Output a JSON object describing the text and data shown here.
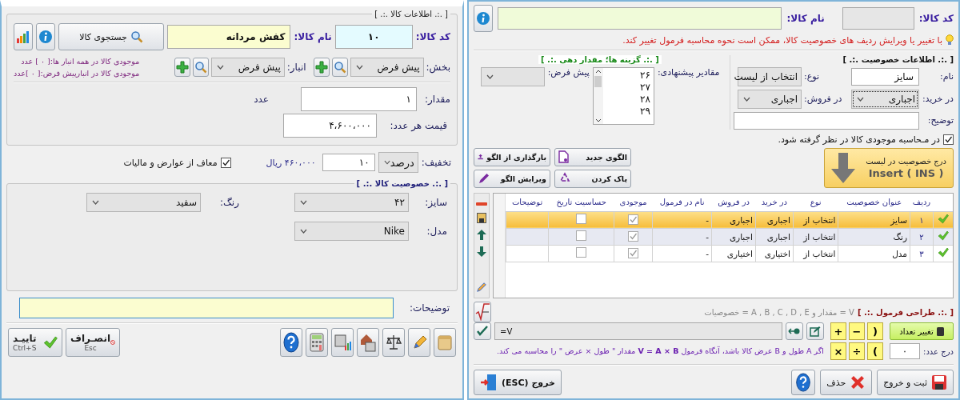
{
  "product_window": {
    "info_legend": "[ .:. اطلاعات کالا .:. ]",
    "code": {
      "label": "کد کالا:",
      "value": "۱۰"
    },
    "name": {
      "label": "نام کالا:",
      "value": "کفش مردانه"
    },
    "search_button": "جستجوی کالا",
    "section": {
      "label": "بخش:",
      "value": "پیش فرض"
    },
    "warehouse": {
      "label": "انبار:",
      "value": "پیش فرض"
    },
    "stock_lines": [
      "موجودی کالا در همه انبار ها:[ ۰ ] عدد",
      "موجودی کالا در انبارپیش فرض:[ ۰ ]عدد"
    ],
    "quantity": {
      "label": "مقدار:",
      "value": "۱",
      "unit": "عدد"
    },
    "unit_price": {
      "label": "قیمت هر عدد:",
      "value": "۴،۶۰۰،۰۰۰"
    },
    "discount": {
      "label": "تخفیف:",
      "type": "درصد",
      "value": "۱۰",
      "amount": "۴۶۰،۰۰۰ ریال"
    },
    "tax_exempt": {
      "label": "معاف از عوارض و مالیات",
      "checked": true
    },
    "features_legend": "[ .:. خصوصیت کالا .:. ]",
    "features": [
      {
        "label": "سایز:",
        "value": "۴۲"
      },
      {
        "label": "رنگ:",
        "value": "سفید"
      },
      {
        "label": "مدل:",
        "value": "Nike"
      }
    ],
    "notes_label": "توضیحات:",
    "cancel": {
      "label": "انصـراف",
      "shortcut": "Esc"
    },
    "confirm": {
      "label": "تاییـد",
      "shortcut": "Ctrl+S"
    }
  },
  "feature_window": {
    "code_label": "کد کالا:",
    "name_label": "نام کالا:",
    "warning": "با تغییر یا ویرایش ردیف های خصوصیت کالا، ممکن است نحوه محاسبه فرمول تغییر کند.",
    "feature_legend": "[ .:. اطلاعات خصوصیت .:. ]",
    "options_legend": "[ .:. گزینه ها؛ مقدار دهی .:. ]",
    "name": {
      "label": "نام:",
      "value": "سایز"
    },
    "type": {
      "label": "نوع:",
      "value": "انتخاب از لیست"
    },
    "purchase": {
      "label": "در خرید:",
      "value": "اجباری",
      "focused": true
    },
    "sale": {
      "label": "در فروش:",
      "value": "اجباری"
    },
    "description_label": "توضیح:",
    "suggested": {
      "label": "مقادیر پیشنهادی:",
      "values": [
        "۲۶",
        "۲۷",
        "۲۸",
        "۲۹"
      ]
    },
    "default_label": "پیش فرض:",
    "stock_check": {
      "label": "در مـحاسبه موجودی کالا در نظر گرفته شود.",
      "checked": true
    },
    "insert_button": {
      "label": "درج خصوصیت در لیست",
      "shortcut": "Insert ( INS )"
    },
    "pattern_buttons": [
      {
        "kind": "new",
        "label": "الگوی جدید"
      },
      {
        "kind": "load",
        "label": "بارگذاری از الگو"
      },
      {
        "kind": "clear",
        "label": "پاک کردن"
      },
      {
        "kind": "edit",
        "label": "ویرایش الگو"
      }
    ],
    "table": {
      "columns": [
        "ردیف",
        "عنوان خصوصیت",
        "نوع",
        "در خرید",
        "در فروش",
        "نام در فرمول",
        "موجودی",
        "حساسیت تاریخ",
        "توضیحات"
      ],
      "rows": [
        {
          "number": "۱",
          "title": "سایز",
          "type": "انتخاب از",
          "purchase": "اجباری",
          "sale": "اجباری",
          "formula_name": "-",
          "in_stock": true,
          "date_sensitive": false,
          "selected": true
        },
        {
          "number": "۲",
          "title": "رنگ",
          "type": "انتخاب از",
          "purchase": "اجباری",
          "sale": "اجباری",
          "formula_name": "-",
          "in_stock": true,
          "date_sensitive": false,
          "selected": false
        },
        {
          "number": "۳",
          "title": "مدل",
          "type": "انتخاب از",
          "purchase": "اختیاری",
          "sale": "اختیاری",
          "formula_name": "-",
          "in_stock": true,
          "date_sensitive": false,
          "selected": false
        }
      ]
    },
    "formula": {
      "legend": "[ .:. طراحی فرمول .:. ]",
      "legend_hint": "V = مقدار و A , B , C , D , E = خصوصیات",
      "value": "V=",
      "operators": [
        ")",
        "−",
        "+",
        "(",
        "÷",
        "×"
      ],
      "change_count": "تغییر تعداد",
      "insert_number": {
        "label": "درج عدد:",
        "value": "۰"
      },
      "hint": "اگر A طول و B عرض کالا باشد، آنگاه فرمول **V = A × B** مقدار \" طول × عرض \" را محاسبه می کند."
    },
    "save_exit": "ثبت و خروج",
    "delete": "حذف",
    "exit": "خروج (ESC)"
  }
}
